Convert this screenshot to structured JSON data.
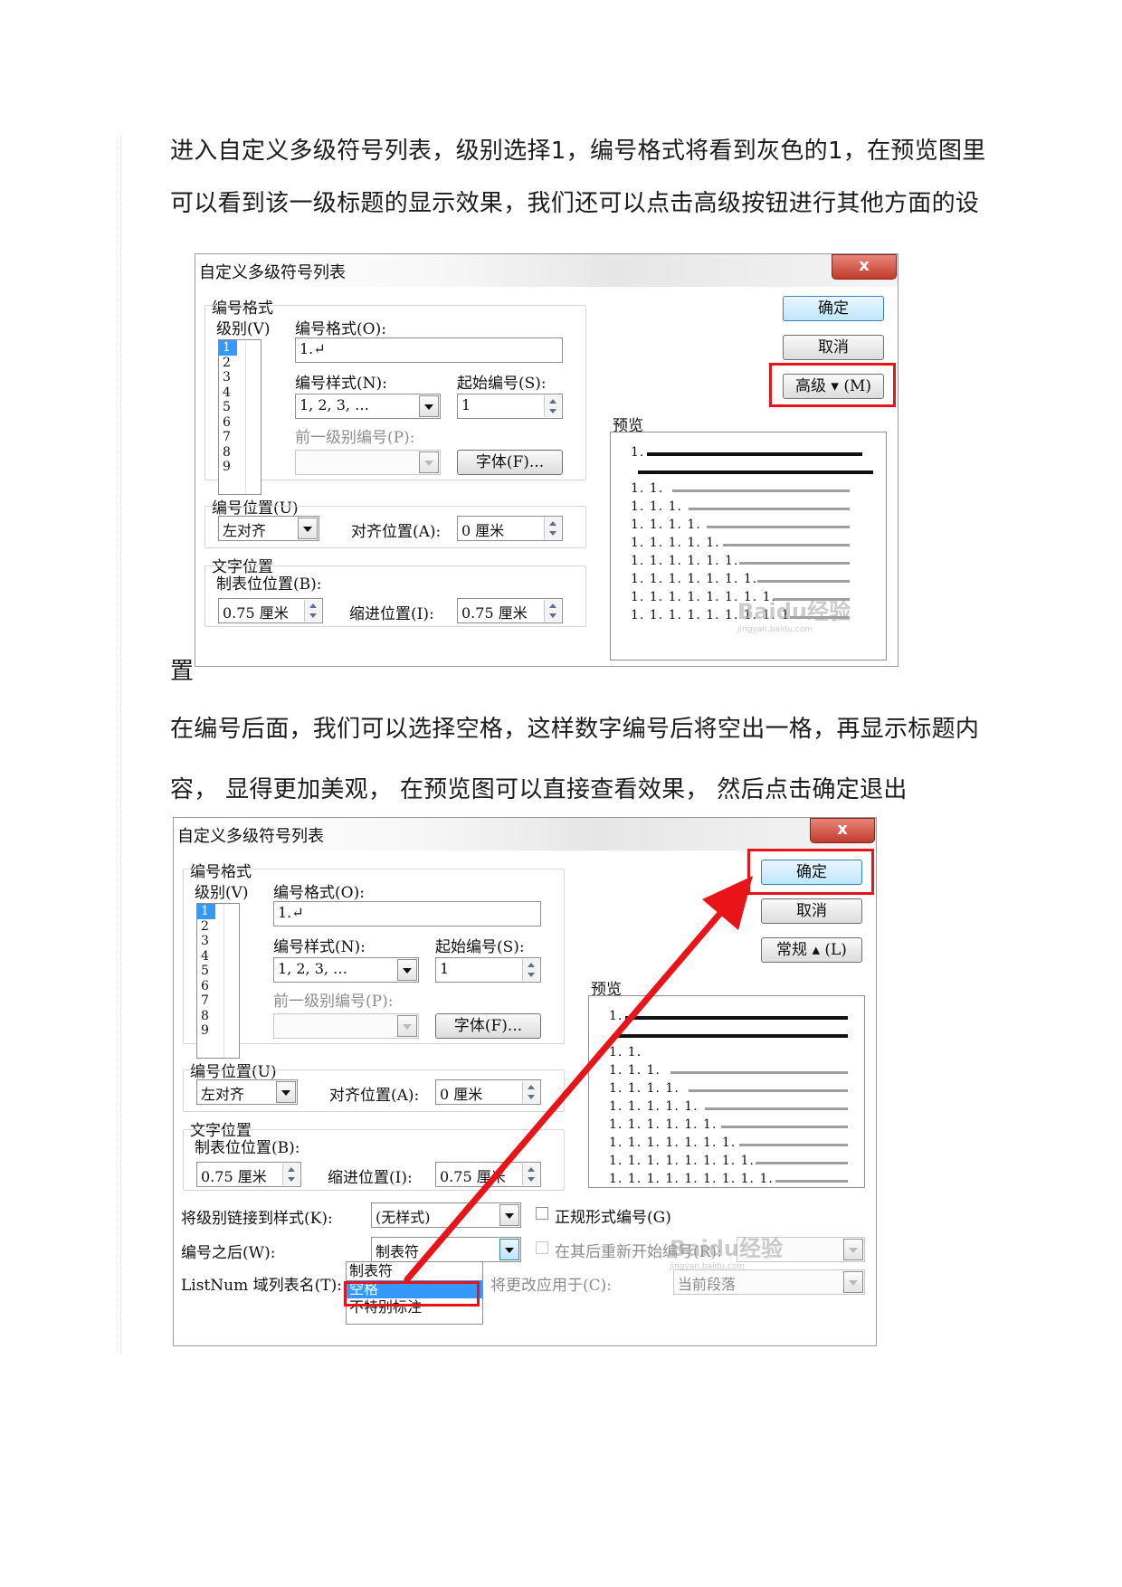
{
  "paragraphs": {
    "p1_line1": "进入自定义多级符号列表，级别选择1，编号格式将看到灰色的1，在预览图里",
    "p1_line2": "可以看到该一级标题的显示效果，我们还可以点击高级按钮进行其他方面的设",
    "p1_line3": "置",
    "p2_line1": "在编号后面，我们可以选择空格，这样数字编号后将空出一格，再显示标题内",
    "p2_line2": "容， 显得更加美观， 在预览图可以直接查看效果， 然后点击确定退出"
  },
  "dialog": {
    "title": "自定义多级符号列表",
    "close_label": "x",
    "number_format_group": "编号格式",
    "level_label": "级别(V)",
    "levels": [
      "1",
      "2",
      "3",
      "4",
      "5",
      "6",
      "7",
      "8",
      "9"
    ],
    "selected_level": "1",
    "number_format_label": "编号格式(O):",
    "number_format_value": "1.↵",
    "number_style_label": "编号样式(N):",
    "number_style_value": "1, 2, 3, …",
    "start_at_label": "起始编号(S):",
    "start_at_value": "1",
    "prev_level_label": "前一级别编号(P):",
    "font_button": "字体(F)...",
    "position_group": "编号位置(U)",
    "alignment_value": "左对齐",
    "aligned_at_label": "对齐位置(A):",
    "aligned_at_value": "0 厘米",
    "text_position_group": "文字位置",
    "tab_position_label": "制表位位置(B):",
    "tab_position_value": "0.75 厘米",
    "indent_label": "缩进位置(I):",
    "indent_value": "0.75 厘米",
    "ok_button": "确定",
    "cancel_button": "取消",
    "more_button": "高级 ▾ (M)",
    "less_button": "常规 ▴ (L)",
    "preview_label": "预览",
    "preview_rows": [
      "1.",
      "1. 1.",
      "1. 1. 1.",
      "1. 1. 1. 1.",
      "1. 1. 1. 1. 1.",
      "1. 1. 1. 1. 1. 1.",
      "1. 1. 1. 1. 1. 1. 1.",
      "1. 1. 1. 1. 1. 1. 1. 1.",
      "1. 1. 1. 1. 1. 1. 1. 1. 1."
    ],
    "link_style_label": "将级别链接到样式(K):",
    "link_style_value": "(无样式)",
    "legal_numbering_label": "正规形式编号(G)",
    "follow_number_label": "编号之后(W):",
    "follow_number_value": "制表符",
    "follow_number_options": [
      "制表符",
      "空格",
      "不特别标注"
    ],
    "follow_number_selected": "空格",
    "restart_label": "在其后重新开始编号(R):",
    "listnum_label": "ListNum 域列表名(T):",
    "apply_to_label": "将更改应用于(C):",
    "apply_to_value": "当前段落"
  },
  "watermark": {
    "brand": "Baidu经验",
    "url": "jingyan.baidu.com"
  },
  "colors": {
    "highlight": "#e8141a",
    "selection": "#3399ff",
    "close_button": "#c13b2c"
  }
}
